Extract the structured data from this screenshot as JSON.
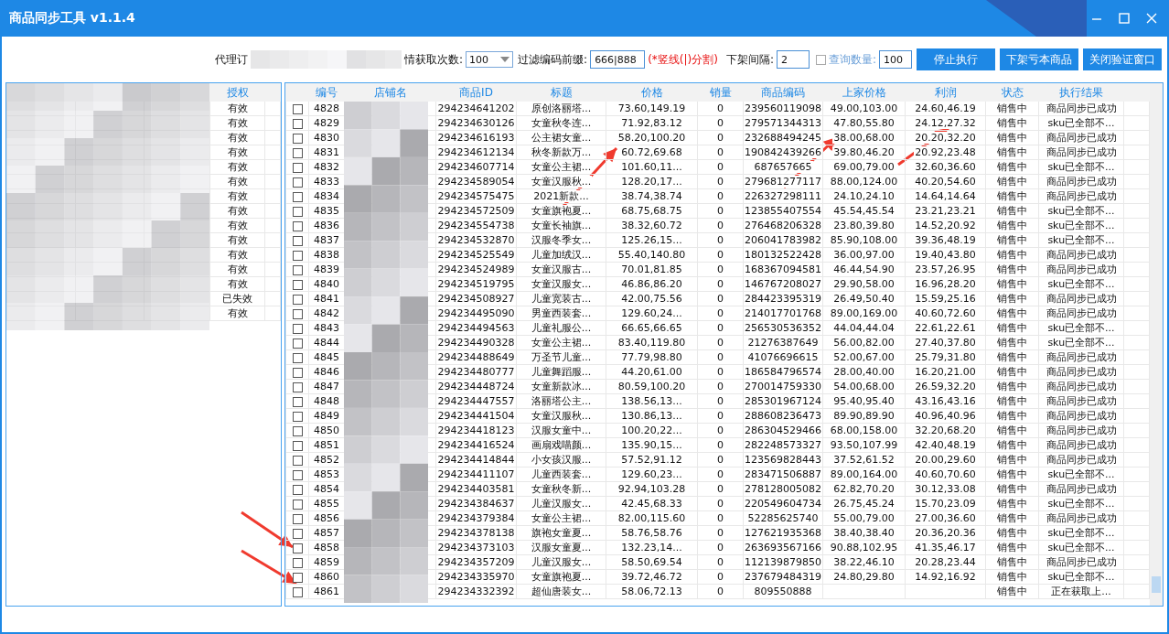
{
  "window": {
    "title": "商品同步工具  v1.1.4"
  },
  "toolbar": {
    "label_start": "代理订",
    "label_end": "情获取次数:",
    "fetch_count": "100",
    "prefix_label": "过滤编码前缀:",
    "prefix_value": "666|888",
    "prefix_hint": "(*竖线(|)分割)",
    "interval_label": "下架间隔:",
    "interval_value": "2",
    "query_checked": false,
    "query_label": "查询数量:",
    "query_value": "100",
    "buttons": [
      "停止执行",
      "下架亏本商品",
      "关闭验证窗口"
    ]
  },
  "accounts": {
    "header": "授权",
    "rows": [
      "有效",
      "有效",
      "有效",
      "有效",
      "有效",
      "有效",
      "有效",
      "有效",
      "有效",
      "有效",
      "有效",
      "有效",
      "有效",
      "已失效",
      "有效"
    ]
  },
  "table": {
    "columns": [
      "编号",
      "店铺名",
      "商品ID",
      "标题",
      "价格",
      "销量",
      "商品编码",
      "上家价格",
      "利润",
      "状态",
      "执行结果"
    ],
    "rows": [
      {
        "checked": false,
        "cells": [
          "4828",
          "",
          "294234641202",
          "原创洛丽塔...",
          "73.60,149.19",
          "0",
          "239560119098",
          "49.00,103.00",
          "24.60,46.19",
          "销售中",
          "商品同步已成功"
        ]
      },
      {
        "checked": false,
        "cells": [
          "4829",
          "",
          "294234630126",
          "女童秋冬连...",
          "71.92,83.12",
          "0",
          "279571344313",
          "47.80,55.80",
          "24.12,27.32",
          "销售中",
          "sku已全部不..."
        ]
      },
      {
        "checked": false,
        "cells": [
          "4830",
          "",
          "294234616193",
          "公主裙女童...",
          "58.20,100.20",
          "0",
          "232688494245",
          "38.00,68.00",
          "20.20,32.20",
          "销售中",
          "商品同步已成功"
        ]
      },
      {
        "checked": false,
        "cells": [
          "4831",
          "",
          "294234612134",
          "秋冬新款万...",
          "60.72,69.68",
          "0",
          "190842439266",
          "39.80,46.20",
          "20.92,23.48",
          "销售中",
          "商品同步已成功"
        ]
      },
      {
        "checked": false,
        "cells": [
          "4832",
          "",
          "294234607714",
          "女童公主裙...",
          "101.60,11...",
          "0",
          "687657665",
          "69.00,79.00",
          "32.60,36.60",
          "销售中",
          "sku已全部不..."
        ]
      },
      {
        "checked": false,
        "cells": [
          "4833",
          "",
          "294234589054",
          "女童汉服秋...",
          "128.20,17...",
          "0",
          "279681277117",
          "88.00,124.00",
          "40.20,54.60",
          "销售中",
          "商品同步已成功"
        ]
      },
      {
        "checked": false,
        "cells": [
          "4834",
          "",
          "294234575475",
          "2021新款...",
          "38.74,38.74",
          "0",
          "226327298111",
          "24.10,24.10",
          "14.64,14.64",
          "销售中",
          "商品同步已成功"
        ]
      },
      {
        "checked": false,
        "cells": [
          "4835",
          "",
          "294234572509",
          "女童旗袍夏...",
          "68.75,68.75",
          "0",
          "123855407554",
          "45.54,45.54",
          "23.21,23.21",
          "销售中",
          "sku已全部不..."
        ]
      },
      {
        "checked": false,
        "cells": [
          "4836",
          "",
          "294234554738",
          "女童长袖旗...",
          "38.32,60.72",
          "0",
          "276468206328",
          "23.80,39.80",
          "14.52,20.92",
          "销售中",
          "sku已全部不..."
        ]
      },
      {
        "checked": false,
        "cells": [
          "4837",
          "",
          "294234532870",
          "汉服冬季女...",
          "125.26,15...",
          "0",
          "206041783982",
          "85.90,108.00",
          "39.36,48.19",
          "销售中",
          "sku已全部不..."
        ]
      },
      {
        "checked": false,
        "cells": [
          "4838",
          "",
          "294234525549",
          "儿童加绒汉...",
          "55.40,140.80",
          "0",
          "180132522428",
          "36.00,97.00",
          "19.40,43.80",
          "销售中",
          "商品同步已成功"
        ]
      },
      {
        "checked": false,
        "cells": [
          "4839",
          "",
          "294234524989",
          "女童汉服古...",
          "70.01,81.85",
          "0",
          "168367094581",
          "46.44,54.90",
          "23.57,26.95",
          "销售中",
          "商品同步已成功"
        ]
      },
      {
        "checked": false,
        "cells": [
          "4840",
          "",
          "294234519795",
          "女童汉服女...",
          "46.86,86.20",
          "0",
          "146767208027",
          "29.90,58.00",
          "16.96,28.20",
          "销售中",
          "sku已全部不..."
        ]
      },
      {
        "checked": false,
        "cells": [
          "4841",
          "",
          "294234508927",
          "儿童宽装古...",
          "42.00,75.56",
          "0",
          "284423395319",
          "26.49,50.40",
          "15.59,25.16",
          "销售中",
          "商品同步已成功"
        ]
      },
      {
        "checked": false,
        "cells": [
          "4842",
          "",
          "294234495090",
          "男童西装套...",
          "129.60,24...",
          "0",
          "214017701768",
          "89.00,169.00",
          "40.60,72.60",
          "销售中",
          "商品同步已成功"
        ]
      },
      {
        "checked": false,
        "cells": [
          "4843",
          "",
          "294234494563",
          "儿童礼服公...",
          "66.65,66.65",
          "0",
          "256530536352",
          "44.04,44.04",
          "22.61,22.61",
          "销售中",
          "sku已全部不..."
        ]
      },
      {
        "checked": false,
        "cells": [
          "4844",
          "",
          "294234490328",
          "女童公主裙...",
          "83.40,119.80",
          "0",
          "21276387649",
          "56.00,82.00",
          "27.40,37.80",
          "销售中",
          "sku已全部不..."
        ]
      },
      {
        "checked": false,
        "cells": [
          "4845",
          "",
          "294234488649",
          "万圣节儿童...",
          "77.79,98.80",
          "0",
          "41076696615",
          "52.00,67.00",
          "25.79,31.80",
          "销售中",
          "商品同步已成功"
        ]
      },
      {
        "checked": false,
        "cells": [
          "4846",
          "",
          "294234480777",
          "儿童舞蹈服...",
          "44.20,61.00",
          "0",
          "186584796574",
          "28.00,40.00",
          "16.20,21.00",
          "销售中",
          "商品同步已成功"
        ]
      },
      {
        "checked": false,
        "cells": [
          "4847",
          "",
          "294234448724",
          "女童新款冰...",
          "80.59,100.20",
          "0",
          "270014759330",
          "54.00,68.00",
          "26.59,32.20",
          "销售中",
          "商品同步已成功"
        ]
      },
      {
        "checked": false,
        "cells": [
          "4848",
          "",
          "294234447557",
          "洛丽塔公主...",
          "138.56,13...",
          "0",
          "285301967124",
          "95.40,95.40",
          "43.16,43.16",
          "销售中",
          "商品同步已成功"
        ]
      },
      {
        "checked": false,
        "cells": [
          "4849",
          "",
          "294234441504",
          "女童汉服秋...",
          "130.86,13...",
          "0",
          "288608236473",
          "89.90,89.90",
          "40.96,40.96",
          "销售中",
          "商品同步已成功"
        ]
      },
      {
        "checked": false,
        "cells": [
          "4850",
          "",
          "294234418123",
          "汉服女童中...",
          "100.20,22...",
          "0",
          "286304529466",
          "68.00,158.00",
          "32.20,68.20",
          "销售中",
          "商品同步已成功"
        ]
      },
      {
        "checked": false,
        "cells": [
          "4851",
          "",
          "294234416524",
          "画扇戏喵颜...",
          "135.90,15...",
          "0",
          "282248573327",
          "93.50,107.99",
          "42.40,48.19",
          "销售中",
          "商品同步已成功"
        ]
      },
      {
        "checked": false,
        "cells": [
          "4852",
          "",
          "294234414844",
          "小女孩汉服...",
          "57.52,91.12",
          "0",
          "123569828443",
          "37.52,61.52",
          "20.00,29.60",
          "销售中",
          "商品同步已成功"
        ]
      },
      {
        "checked": false,
        "cells": [
          "4853",
          "",
          "294234411107",
          "儿童西装套...",
          "129.60,23...",
          "0",
          "283471506887",
          "89.00,164.00",
          "40.60,70.60",
          "销售中",
          "sku已全部不..."
        ]
      },
      {
        "checked": false,
        "cells": [
          "4854",
          "",
          "294234403581",
          "女童秋冬新...",
          "92.94,103.28",
          "0",
          "278128005082",
          "62.82,70.20",
          "30.12,33.08",
          "销售中",
          "商品同步已成功"
        ]
      },
      {
        "checked": false,
        "cells": [
          "4855",
          "",
          "294234384637",
          "儿童汉服女...",
          "42.45,68.33",
          "0",
          "220549604734",
          "26.75,45.24",
          "15.70,23.09",
          "销售中",
          "sku已全部不..."
        ]
      },
      {
        "checked": false,
        "cells": [
          "4856",
          "",
          "294234379384",
          "女童公主裙...",
          "82.00,115.60",
          "0",
          "52285625740",
          "55.00,79.00",
          "27.00,36.60",
          "销售中",
          "商品同步已成功"
        ]
      },
      {
        "checked": false,
        "cells": [
          "4857",
          "",
          "294234378138",
          "旗袍女童夏...",
          "58.76,58.76",
          "0",
          "127621935368",
          "38.40,38.40",
          "20.36,20.36",
          "销售中",
          "sku已全部不..."
        ]
      },
      {
        "checked": false,
        "cells": [
          "4858",
          "",
          "294234373103",
          "汉服女童夏...",
          "132.23,14...",
          "0",
          "263693567166",
          "90.88,102.95",
          "41.35,46.17",
          "销售中",
          "sku已全部不..."
        ]
      },
      {
        "checked": false,
        "cells": [
          "4859",
          "",
          "294234357209",
          "儿童汉服女...",
          "58.50,69.54",
          "0",
          "112139879850",
          "38.22,46.10",
          "20.28,23.44",
          "销售中",
          "商品同步已成功"
        ]
      },
      {
        "checked": false,
        "cells": [
          "4860",
          "",
          "294234335970",
          "女童旗袍夏...",
          "39.72,46.72",
          "0",
          "237679484319",
          "24.80,29.80",
          "14.92,16.92",
          "销售中",
          "sku已全部不..."
        ]
      },
      {
        "checked": false,
        "cells": [
          "4861",
          "",
          "294234332392",
          "超仙唐装女...",
          "58.06,72.13",
          "0",
          "809550888",
          "",
          "",
          "销售中",
          "正在获取上..."
        ]
      }
    ]
  }
}
